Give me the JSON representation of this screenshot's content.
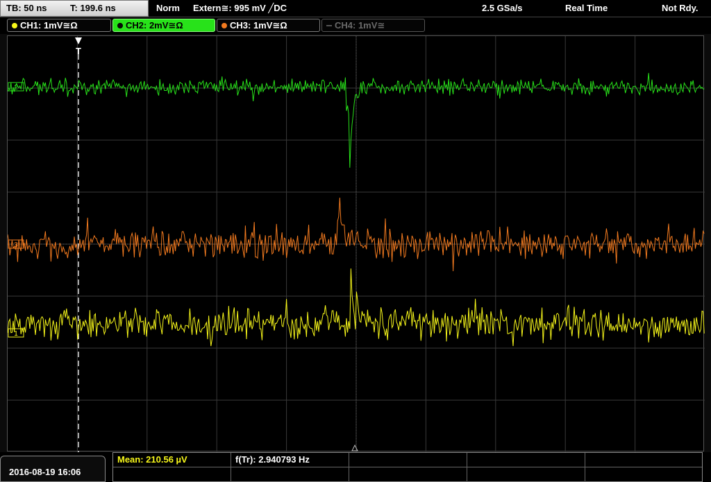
{
  "header": {
    "timebase": "TB: 50 ns",
    "trigger_position": "T: 199.6 ns",
    "trigger_mode": "Norm",
    "trigger_source": "Extern≅: 995 mV ╱DC",
    "sample_rate": "2.5 GSa/s",
    "acquisition_mode": "Real Time",
    "status": "Not Rdy."
  },
  "channels": [
    {
      "label": "CH1: 1mV≅Ω",
      "color": "#f7f71a",
      "active": false,
      "enabled": true
    },
    {
      "label": "CH2: 2mV≅Ω",
      "color": "#28e21a",
      "active": true,
      "enabled": true
    },
    {
      "label": "CH3: 1mV≅Ω",
      "color": "#f27a1f",
      "active": false,
      "enabled": true
    },
    {
      "label": "CH4: 1mV≅",
      "color": "#6a6a6a",
      "active": false,
      "enabled": false
    }
  ],
  "markers": {
    "trigger_marker": "T",
    "ch1_marker": "1",
    "ch2_marker": "2",
    "ch3_marker": "3"
  },
  "measurements": {
    "mean": "Mean: 210.56 µV",
    "frequency": "f(Tr): 2.940793 Hz"
  },
  "footer": {
    "datetime": "2016-08-19 16:06"
  },
  "colors": {
    "ch1": "#f7f71a",
    "ch2": "#28e21a",
    "ch3": "#f27a1f",
    "grid": "#3a3a3a",
    "trigger_line": "#ffffff",
    "mean_text": "#f7f71a"
  }
}
